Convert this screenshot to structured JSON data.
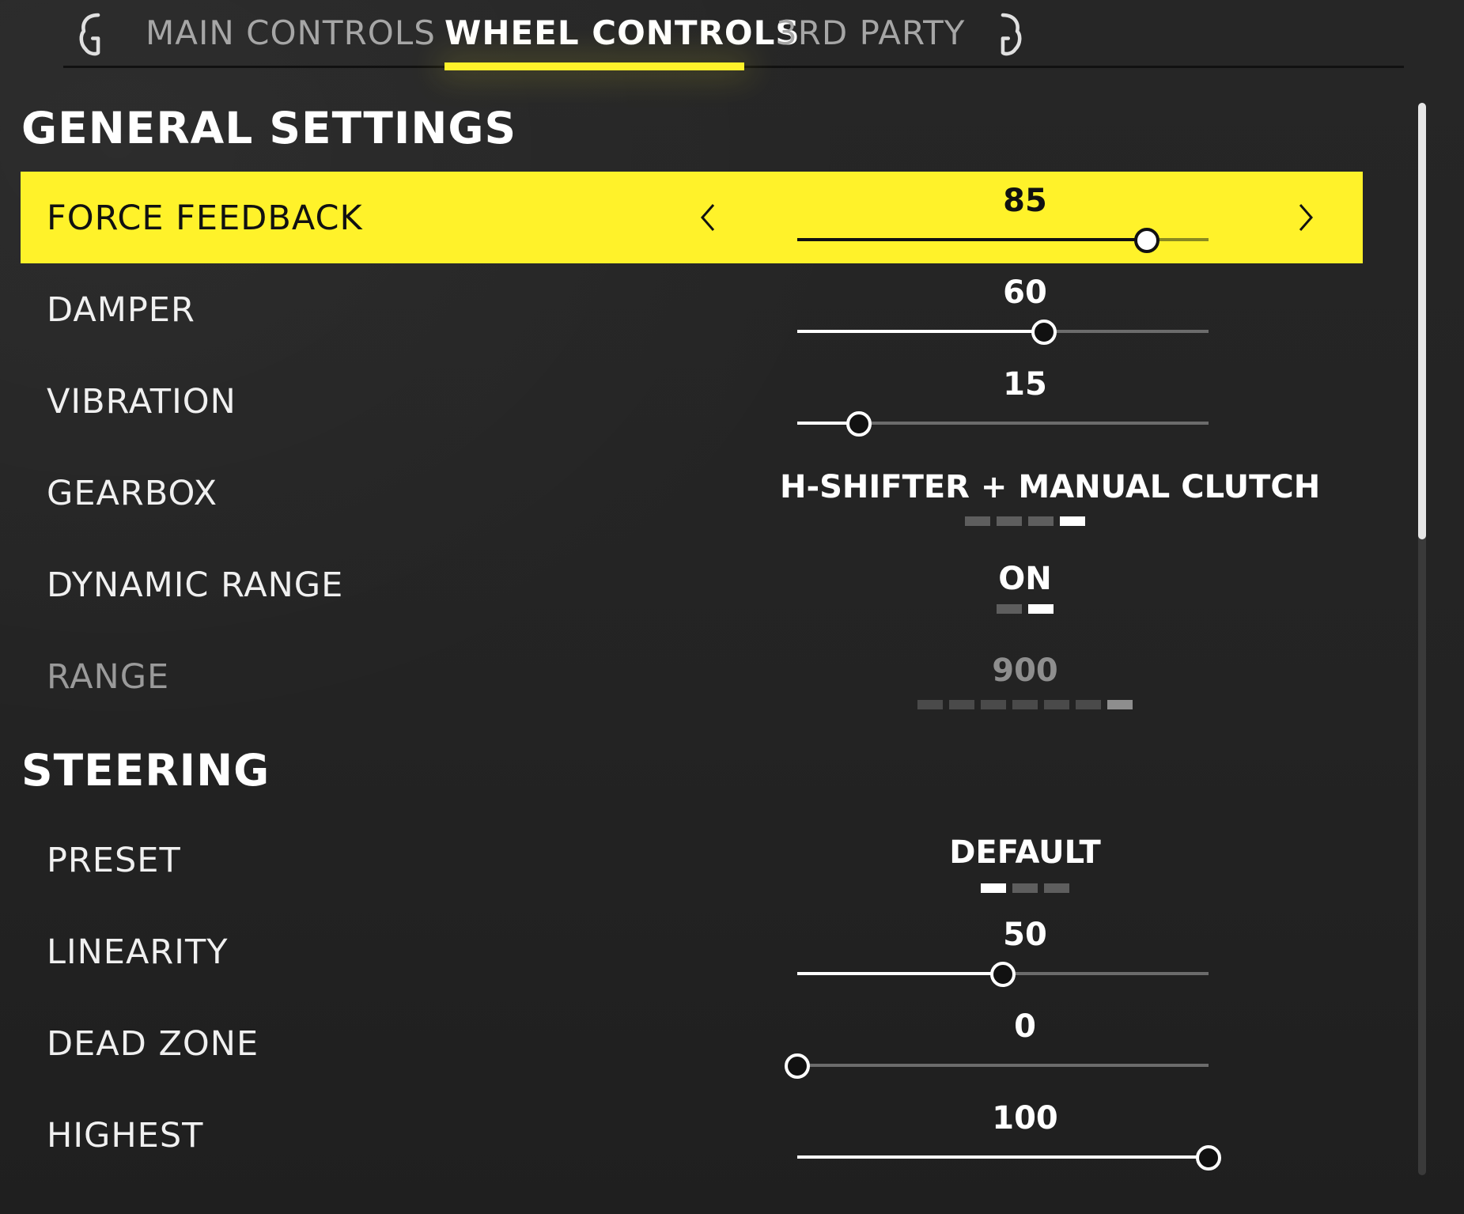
{
  "tabs": {
    "left_bumper_icon": "lb-bumper-icon",
    "right_bumper_icon": "rb-bumper-icon",
    "items": [
      {
        "label": "MAIN CONTROLS",
        "active": false
      },
      {
        "label": "WHEEL CONTROLS",
        "active": true
      },
      {
        "label": "3RD PARTY",
        "active": false
      }
    ]
  },
  "general": {
    "title": "GENERAL SETTINGS",
    "force_feedback": {
      "label": "FORCE FEEDBACK",
      "value": "85",
      "level": 0.85
    },
    "damper": {
      "label": "DAMPER",
      "value": "60",
      "level": 0.6
    },
    "vibration": {
      "label": "VIBRATION",
      "value": "15",
      "level": 0.15
    },
    "gearbox": {
      "label": "GEARBOX",
      "value": "H-SHIFTER + MANUAL CLUTCH",
      "option_index": 4,
      "option_count": 4
    },
    "dynamic_range": {
      "label": "DYNAMIC RANGE",
      "value": "ON",
      "option_index": 2,
      "option_count": 2
    },
    "range": {
      "label": "RANGE",
      "value": "900",
      "option_index": 7,
      "option_count": 7
    }
  },
  "steering": {
    "title": "STEERING",
    "preset": {
      "label": "PRESET",
      "value": "DEFAULT",
      "option_index": 1,
      "option_count": 3
    },
    "linearity": {
      "label": "LINEARITY",
      "value": "50",
      "level": 0.5
    },
    "dead_zone": {
      "label": "DEAD ZONE",
      "value": "0",
      "level": 0.0
    },
    "highest": {
      "label": "HIGHEST",
      "value": "100",
      "level": 1.0
    }
  },
  "colors": {
    "accent": "#fff22a",
    "background": "#252525"
  },
  "icons": {
    "prev": "chevron-left-icon",
    "next": "chevron-right-icon"
  }
}
